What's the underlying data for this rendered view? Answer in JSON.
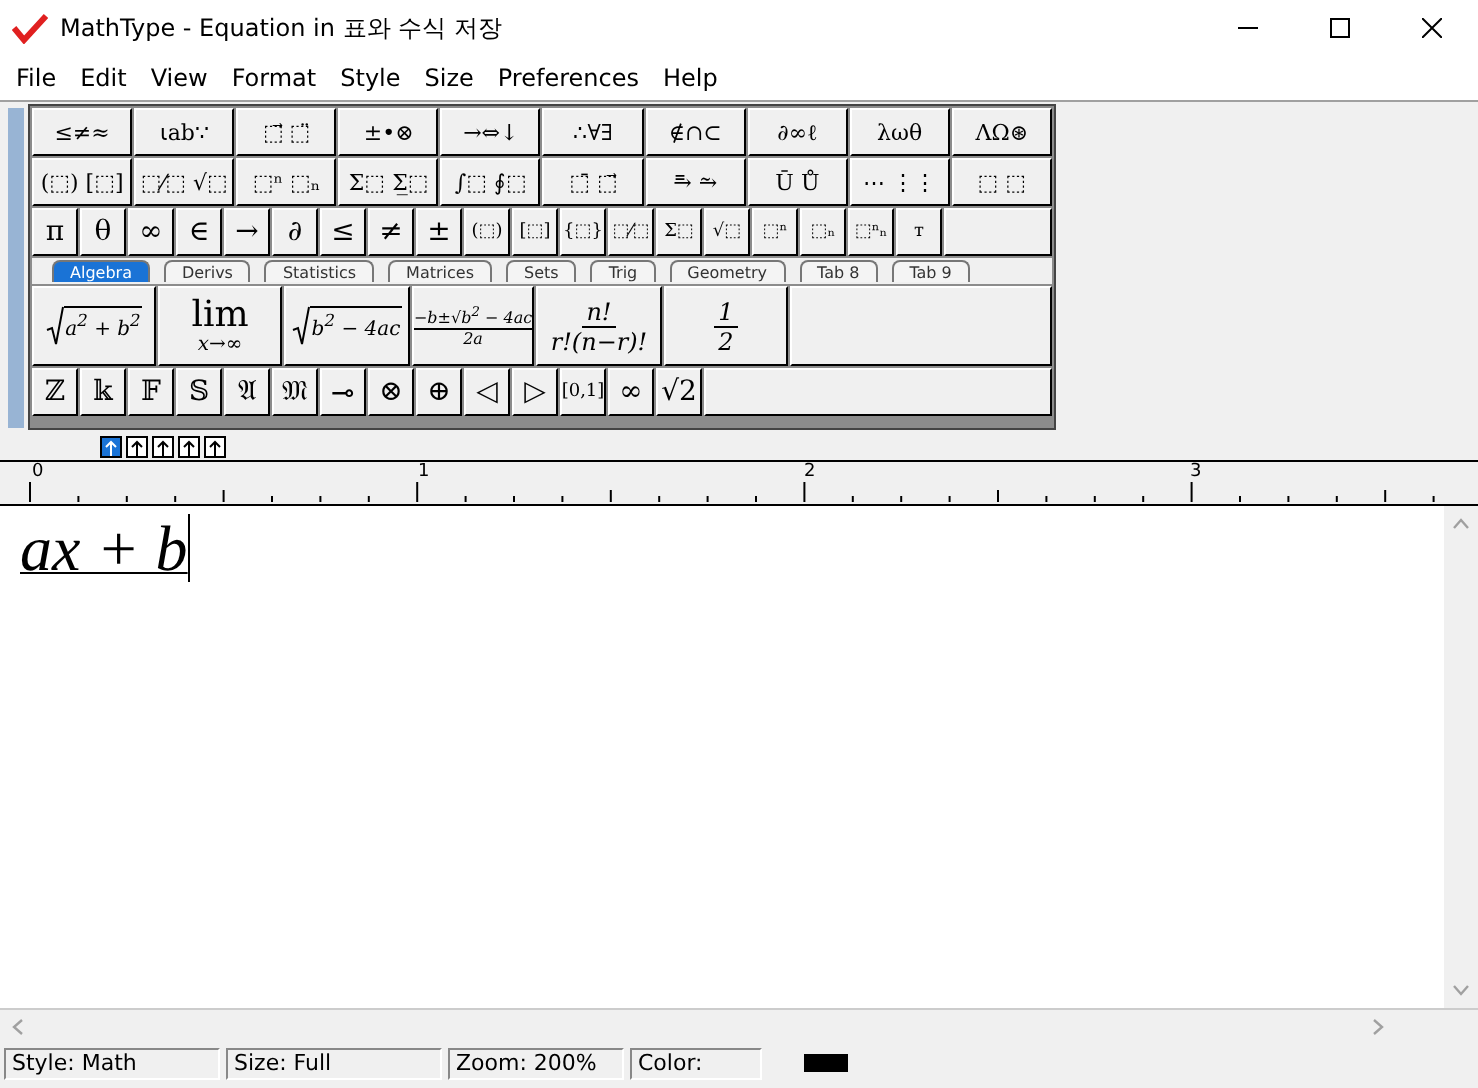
{
  "window": {
    "title": "MathType - Equation in 표와 수식 저장"
  },
  "menu": [
    "File",
    "Edit",
    "View",
    "Format",
    "Style",
    "Size",
    "Preferences",
    "Help"
  ],
  "symbol_palettes": [
    [
      "≤≠≈",
      "⍳ab∵",
      "⬚⃗ ⬚̈",
      "±•⊗",
      "→⇔↓",
      "∴∀∃",
      "∉∩⊂",
      "∂∞ℓ",
      "λωθ",
      "ΛΩ⊛"
    ],
    [
      "(⬚) [⬚]",
      "⬚⁄⬚ √⬚",
      "⬚ⁿ ⬚ₙ",
      "Σ⬚ Σ̲⬚",
      "∫⬚ ∮⬚",
      "⬚̄ ⬚⃗",
      "⥱ ⥲",
      "Ū Ů",
      "⋯ ⋮⋮",
      "⬚ ⬚"
    ]
  ],
  "small_bar": [
    "π",
    "θ",
    "∞",
    "∈",
    "→",
    "∂",
    "≤",
    "≠",
    "±",
    "(⬚)",
    "[⬚]",
    "{⬚}",
    "⬚⁄⬚",
    "Σ⬚",
    "√⬚",
    "⬚ⁿ",
    "⬚ₙ",
    "⬚ⁿₙ",
    "ᴛ"
  ],
  "palette_tabs": [
    {
      "label": "Algebra",
      "selected": true
    },
    {
      "label": "Derivs",
      "selected": false
    },
    {
      "label": "Statistics",
      "selected": false
    },
    {
      "label": "Matrices",
      "selected": false
    },
    {
      "label": "Sets",
      "selected": false
    },
    {
      "label": "Trig",
      "selected": false
    },
    {
      "label": "Geometry",
      "selected": false
    },
    {
      "label": "Tab 8",
      "selected": false
    },
    {
      "label": "Tab 9",
      "selected": false
    }
  ],
  "tab_expressions": [
    {
      "kind": "sqrt",
      "body": "a$^{2}$ + b$^{2}$"
    },
    {
      "kind": "limit",
      "top": "lim",
      "bottom": "x→∞"
    },
    {
      "kind": "sqrt",
      "body": "b$^{2}$ − 4ac"
    },
    {
      "kind": "fraction",
      "numerator": "−b±√b$^{2}$ − 4ac",
      "denominator": "2a"
    },
    {
      "kind": "fraction",
      "numerator": "n!",
      "denominator": "r!(n−r)!"
    },
    {
      "kind": "fraction",
      "numerator": "1",
      "denominator": "2"
    }
  ],
  "bottom_bar": [
    "ℤ",
    "𝕜",
    "𝔽",
    "𝕊",
    "𝔄",
    "𝔐",
    "⊸",
    "⊗",
    "⊕",
    "◁",
    "▷",
    "[0,1]",
    "∞",
    "√2"
  ],
  "level_buttons": [
    {
      "selected": true
    },
    {
      "selected": false
    },
    {
      "selected": false
    },
    {
      "selected": false
    },
    {
      "selected": false
    }
  ],
  "ruler": {
    "labels": [
      "0",
      "1",
      "2",
      "3"
    ]
  },
  "equation": "ax + b",
  "status_bar": {
    "style": "Style: Math",
    "size": "Size: Full",
    "zoom": "Zoom: 200%",
    "color_label": "Color:",
    "color": "#000000"
  }
}
